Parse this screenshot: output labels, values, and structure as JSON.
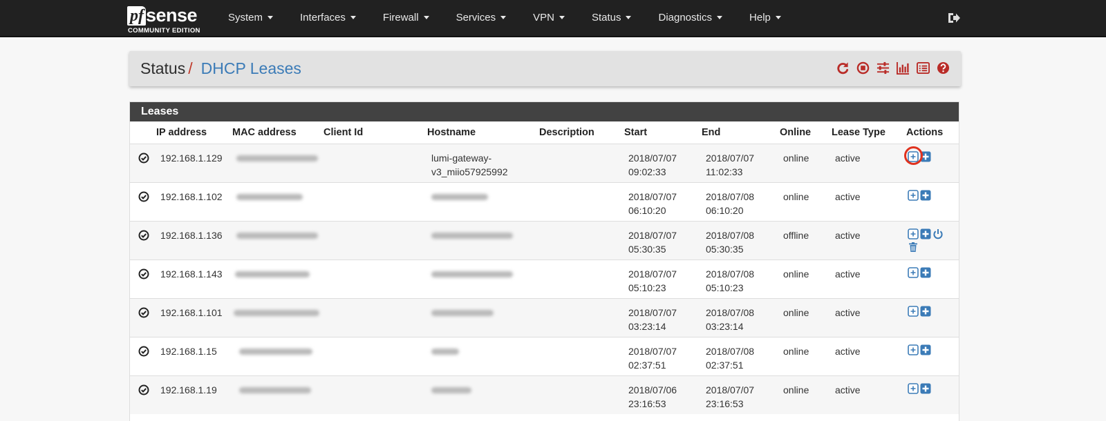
{
  "navbar": {
    "brand_prefix": "pf",
    "brand_name": "sense",
    "brand_edition": "COMMUNITY EDITION",
    "menu": [
      {
        "label": "System"
      },
      {
        "label": "Interfaces"
      },
      {
        "label": "Firewall"
      },
      {
        "label": "Services"
      },
      {
        "label": "VPN"
      },
      {
        "label": "Status"
      },
      {
        "label": "Diagnostics"
      },
      {
        "label": "Help"
      }
    ],
    "logout_icon": "sign-out-icon"
  },
  "breadcrumb": {
    "root": "Status",
    "separator": "/",
    "current": "DHCP Leases",
    "icons": [
      "refresh-icon",
      "stop-icon",
      "sliders-icon",
      "chart-icon",
      "list-icon",
      "help-icon"
    ],
    "icon_color": "#b92c28"
  },
  "leases": {
    "title": "Leases",
    "columns": [
      "IP address",
      "MAC address",
      "Client Id",
      "Hostname",
      "Description",
      "Start",
      "End",
      "Online",
      "Lease Type",
      "Actions"
    ],
    "rows": [
      {
        "ip": "192.168.1.129",
        "hostname_line1": "lumi-gateway-",
        "hostname_line2": "v3_miio57925992",
        "start_date": "2018/07/07",
        "start_time": "09:02:33",
        "end_date": "2018/07/07",
        "end_time": "11:02:33",
        "online": "online",
        "type": "active",
        "actions": [
          "plus-square-outline-icon",
          "plus-square-icon"
        ]
      },
      {
        "ip": "192.168.1.102",
        "hostname_line1": "",
        "hostname_line2": "",
        "start_date": "2018/07/07",
        "start_time": "06:10:20",
        "end_date": "2018/07/08",
        "end_time": "06:10:20",
        "online": "online",
        "type": "active",
        "actions": [
          "plus-square-outline-icon",
          "plus-square-icon"
        ]
      },
      {
        "ip": "192.168.1.136",
        "hostname_line1": "",
        "hostname_line2": "",
        "start_date": "2018/07/07",
        "start_time": "05:30:35",
        "end_date": "2018/07/08",
        "end_time": "05:30:35",
        "online": "offline",
        "type": "active",
        "actions": [
          "plus-square-outline-icon",
          "plus-square-icon",
          "power-icon",
          "trash-icon"
        ]
      },
      {
        "ip": "192.168.1.143",
        "hostname_line1": "",
        "hostname_line2": "",
        "start_date": "2018/07/07",
        "start_time": "05:10:23",
        "end_date": "2018/07/08",
        "end_time": "05:10:23",
        "online": "online",
        "type": "active",
        "actions": [
          "plus-square-outline-icon",
          "plus-square-icon"
        ]
      },
      {
        "ip": "192.168.1.101",
        "hostname_line1": "",
        "hostname_line2": "",
        "start_date": "2018/07/07",
        "start_time": "03:23:14",
        "end_date": "2018/07/08",
        "end_time": "03:23:14",
        "online": "online",
        "type": "active",
        "actions": [
          "plus-square-outline-icon",
          "plus-square-icon"
        ]
      },
      {
        "ip": "192.168.1.15",
        "hostname_line1": "",
        "hostname_line2": "",
        "start_date": "2018/07/07",
        "start_time": "02:37:51",
        "end_date": "2018/07/08",
        "end_time": "02:37:51",
        "online": "online",
        "type": "active",
        "actions": [
          "plus-square-outline-icon",
          "plus-square-icon"
        ]
      },
      {
        "ip": "192.168.1.19",
        "hostname_line1": "",
        "hostname_line2": "",
        "start_date": "2018/07/06",
        "start_time": "23:16:53",
        "end_date": "2018/07/07",
        "end_time": "23:16:53",
        "online": "online",
        "type": "active",
        "actions": [
          "plus-square-outline-icon",
          "plus-square-icon"
        ]
      }
    ]
  },
  "colors": {
    "navbar_bg": "#212121",
    "link_blue": "#3b7bb7",
    "accent_red": "#c03a2b",
    "panel_header": "#424242"
  }
}
